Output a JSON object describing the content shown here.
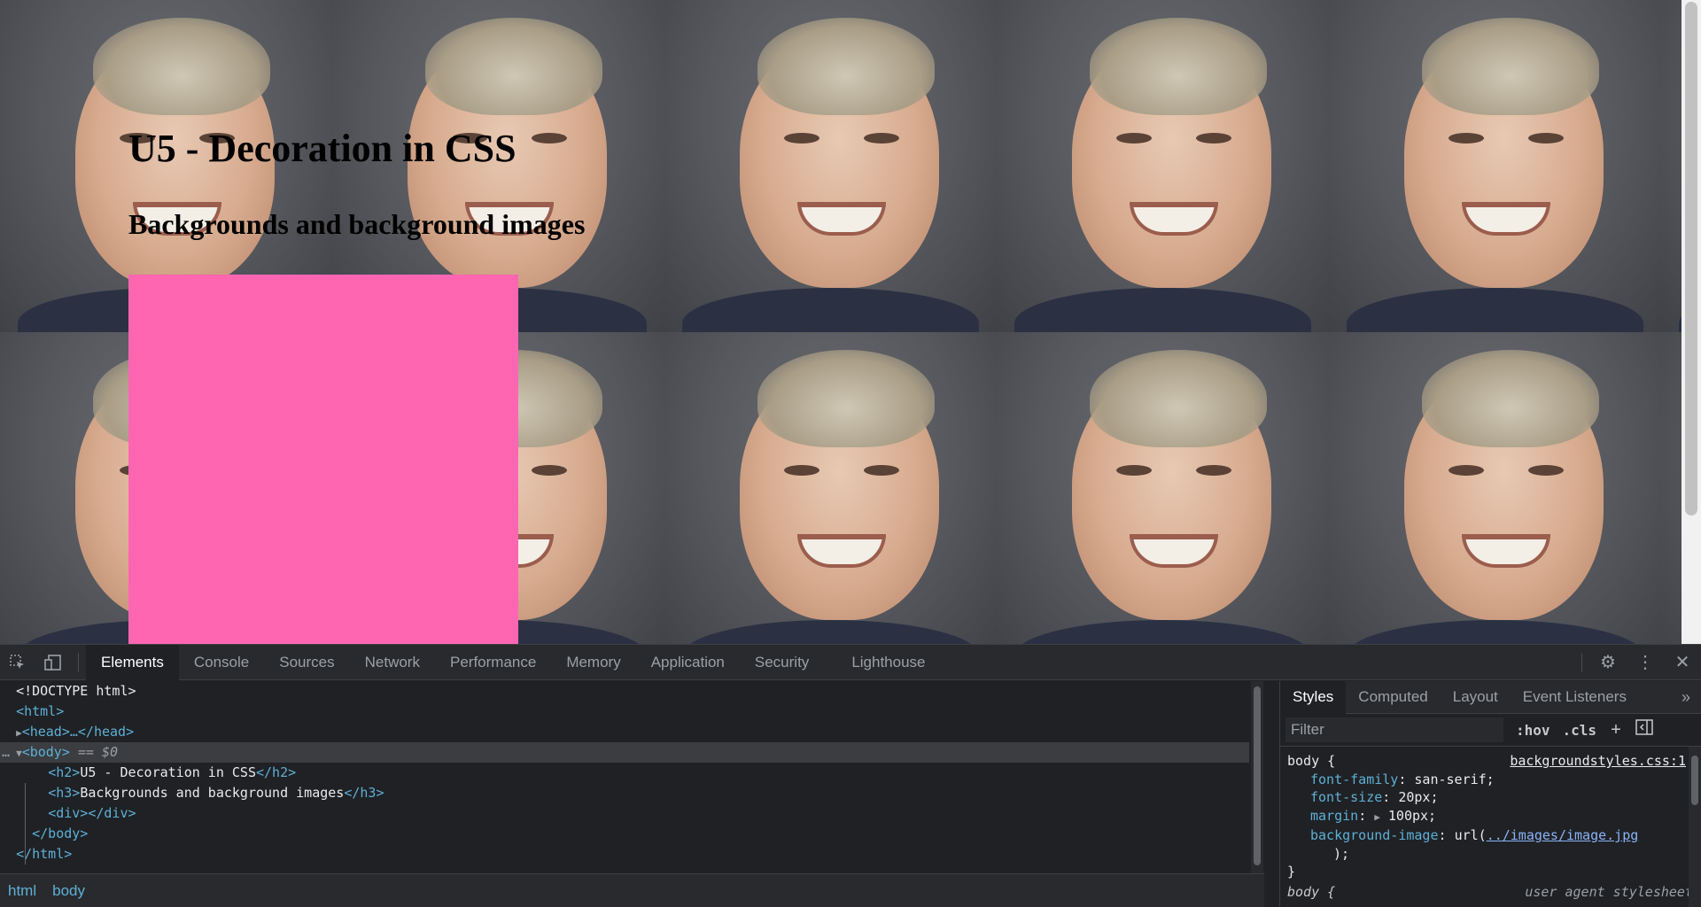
{
  "page": {
    "heading": "U5 - Decoration in CSS",
    "subheading": "Backgrounds and background images",
    "box_color": "#ff66b2",
    "background_image": "portrait-photo-image"
  },
  "devtools": {
    "tabs": [
      "Elements",
      "Console",
      "Sources",
      "Network",
      "Performance",
      "Memory",
      "Application",
      "Security",
      "Lighthouse"
    ],
    "active_tab": "Elements",
    "toolbar_icons": [
      "inspect-element-icon",
      "device-toggle-icon"
    ],
    "right_icons": [
      "settings-gear-icon",
      "more-options-icon",
      "close-icon"
    ],
    "dom": {
      "doctype": "<!DOCTYPE html>",
      "html_open": "<html>",
      "head_collapsed": "<head>…</head>",
      "body_open": "<body>",
      "body_marker": "== $0",
      "h2_open": "<h2>",
      "h2_text": "U5 - Decoration in CSS",
      "h2_close": "</h2>",
      "h3_open": "<h3>",
      "h3_text": "Backgrounds and background images",
      "h3_close": "</h3>",
      "div": "<div></div>",
      "body_close": "</body>",
      "html_close": "</html>"
    },
    "breadcrumb": [
      "html",
      "body"
    ],
    "styles": {
      "tabs": [
        "Styles",
        "Computed",
        "Layout",
        "Event Listeners"
      ],
      "active_tab": "Styles",
      "filter_placeholder": "Filter",
      "hov": ":hov",
      "cls": ".cls",
      "rule": {
        "selector": "body {",
        "source": "backgroundstyles.css:1",
        "properties": [
          {
            "name": "font-family",
            "value": "san-serif;"
          },
          {
            "name": "font-size",
            "value": "20px;"
          },
          {
            "name": "margin",
            "value": "100px;"
          }
        ],
        "bg_name": "background-image",
        "bg_prefix": "url(",
        "bg_link": "../images/image.jpg",
        "bg_suffix": ");",
        "close": "}"
      },
      "ua_selector": "body {",
      "ua_source": "user agent stylesheet"
    }
  }
}
